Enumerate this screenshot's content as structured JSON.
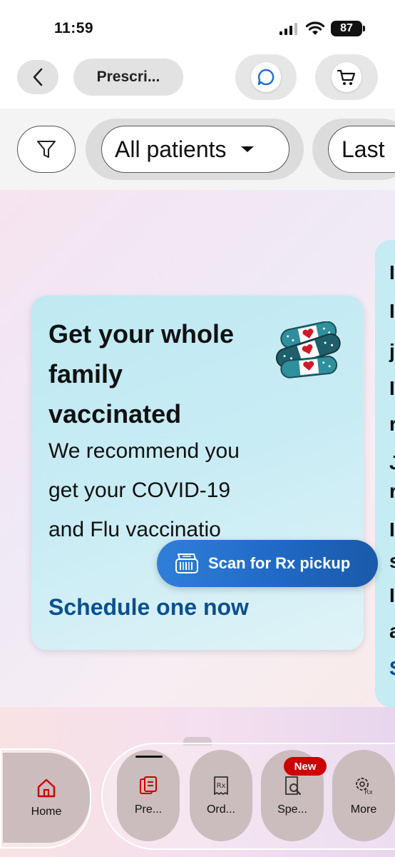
{
  "status_bar": {
    "time": "11:59",
    "battery": "87"
  },
  "header": {
    "title": "Prescri...",
    "back_icon": "chevron-left-icon",
    "chat_icon": "chat-bubble-icon",
    "cart_icon": "shopping-cart-icon"
  },
  "filters": {
    "filter_icon": "funnel-icon",
    "patients_chip": "All patients",
    "date_chip": "Last"
  },
  "promo_card": {
    "title": "Get your whole family vaccinated",
    "body": "We recommend you get your COVID-19 and Flu vaccinatio",
    "link": "Schedule one now",
    "illustration": "bandages-hearts-icon"
  },
  "next_card_partial_letters": [
    "I",
    "I",
    "j",
    "I",
    "r",
    "J",
    "r",
    "I",
    "s",
    "I",
    "a",
    "S"
  ],
  "scan_button": {
    "label": "Scan for Rx pickup",
    "icon": "barcode-scan-icon"
  },
  "bottom_nav": {
    "home": "Home",
    "items": [
      {
        "label": "Pre...",
        "icon": "prescriptions-icon"
      },
      {
        "label": "Ord...",
        "icon": "rx-order-icon"
      },
      {
        "label": "Spe...",
        "icon": "rx-search-icon",
        "badge": "New"
      },
      {
        "label": "More",
        "icon": "more-gear-icon"
      }
    ]
  },
  "colors": {
    "accent_red": "#cc0000",
    "link_blue": "#0b4f8e",
    "scan_blue": "#1f67c2",
    "card_teal": "#c5ebf3"
  }
}
